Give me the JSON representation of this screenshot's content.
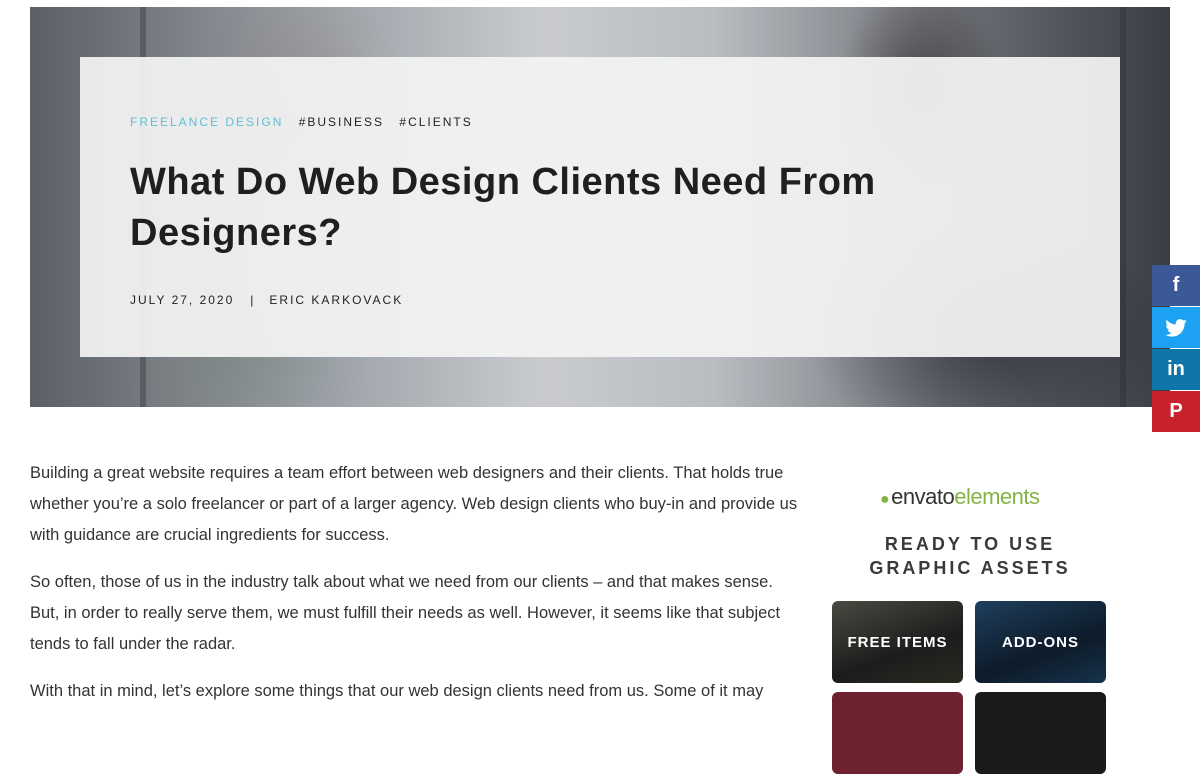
{
  "hero": {
    "category": "FREELANCE DESIGN",
    "tags": [
      "#BUSINESS",
      "#CLIENTS"
    ],
    "title": "What Do Web Design Clients Need From Designers?",
    "date": "JULY 27, 2020",
    "separator": "|",
    "author": "ERIC KARKOVACK"
  },
  "share": {
    "facebook": "f",
    "twitter": "t",
    "linkedin": "in",
    "pinterest": "P"
  },
  "article": {
    "paragraphs": [
      "Building a great website requires a team effort between web designers and their clients. That holds true whether you’re a solo freelancer or part of a larger agency. Web design clients who buy-in and provide us with guidance are crucial ingredients for success.",
      "So often, those of us in the industry talk about what we need from our clients – and that makes sense. But, in order to really serve them, we must fulfill their needs as well. However, it seems like that subject tends to fall under the radar.",
      "With that in mind, let’s explore some things that our web design clients need from us. Some of it may"
    ]
  },
  "ad": {
    "logo_part1": "envato",
    "logo_part2": "elements",
    "headline_line1": "READY TO USE",
    "headline_line2": "GRAPHIC ASSETS",
    "tile1": "FREE ITEMS",
    "tile2": "ADD-ONS"
  },
  "icons": {
    "facebook": "facebook-icon",
    "twitter": "twitter-icon",
    "linkedin": "linkedin-icon",
    "pinterest": "pinterest-icon",
    "leaf": "envato-leaf-icon"
  },
  "colors": {
    "category_accent": "#5bc0d8",
    "facebook": "#3b5998",
    "twitter": "#1da1f2",
    "linkedin": "#0e76a8",
    "pinterest": "#c8232c",
    "envato_green": "#82b541"
  }
}
